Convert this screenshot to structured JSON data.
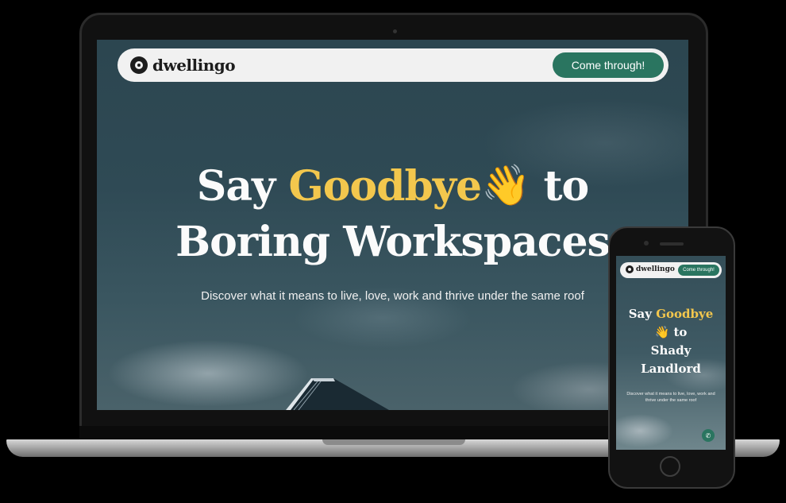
{
  "desktop": {
    "logo_text": "dwellingo",
    "cta_label": "Come through!",
    "headline": {
      "say": "Say",
      "goodbye": "Goodbye",
      "wave": "👋",
      "to": "to",
      "line2": "Boring Workspaces"
    },
    "subheadline": "Discover what it means to live, love, work and thrive under the same roof"
  },
  "mobile": {
    "logo_text": "dwellingo",
    "cta_label": "Come through!",
    "headline": {
      "say": "Say",
      "goodbye": "Goodbye",
      "wave": "👋",
      "to": "to",
      "line3": "Shady",
      "line4": "Landlord"
    },
    "subheadline": "Discover what it means to live, love, work and thrive under the same roof",
    "fab_icon": "phone-icon"
  },
  "colors": {
    "accent": "#2a7560",
    "highlight": "#f3c74d",
    "navbar": "#f1f1f1"
  }
}
